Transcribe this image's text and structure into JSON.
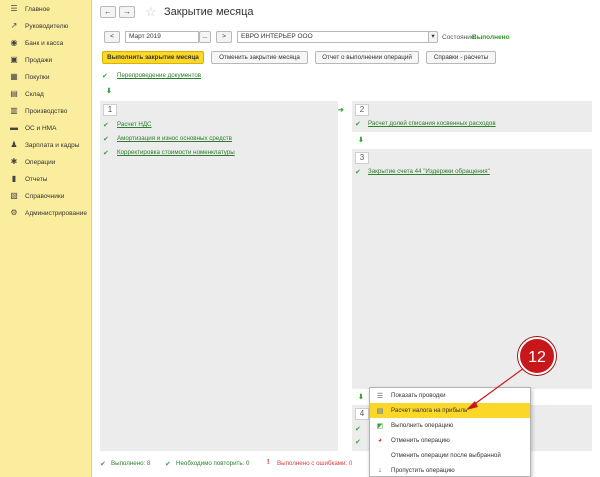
{
  "sidebar": {
    "items": [
      {
        "label": "Главное",
        "icon": "menu-icon"
      },
      {
        "label": "Руководителю",
        "icon": "chart-trend-icon"
      },
      {
        "label": "Банк и касса",
        "icon": "bank-icon"
      },
      {
        "label": "Продажи",
        "icon": "cart-sales-icon"
      },
      {
        "label": "Покупки",
        "icon": "cart-purchase-icon"
      },
      {
        "label": "Склад",
        "icon": "warehouse-icon"
      },
      {
        "label": "Производство",
        "icon": "factory-icon"
      },
      {
        "label": "ОС и НМА",
        "icon": "truck-icon"
      },
      {
        "label": "Зарплата и кадры",
        "icon": "people-icon"
      },
      {
        "label": "Операции",
        "icon": "operations-icon"
      },
      {
        "label": "Отчеты",
        "icon": "reports-icon"
      },
      {
        "label": "Справочники",
        "icon": "books-icon"
      },
      {
        "label": "Администрирование",
        "icon": "gear-icon"
      }
    ]
  },
  "header": {
    "back_icon": "←",
    "forward_icon": "→",
    "star_icon": "☆",
    "title": "Закрытие месяца"
  },
  "filters": {
    "prev": "<",
    "period": "Март 2019",
    "period_picker": "...",
    "next": ">",
    "organization": "ЕВРО ИНТЕРЬЕР ООО",
    "org_dropdown": "▾",
    "state_label": "Состояние:",
    "state_value": "Выполнено"
  },
  "toolbar": {
    "run": "Выполнить закрытие месяца",
    "cancel": "Отменить закрытие месяца",
    "report": "Отчет о выполнении операций",
    "help": "Справки - расчеты"
  },
  "top_link": "Перепроведение документов",
  "panel1": {
    "number": "1",
    "items": [
      "Расчет НДС",
      "Амортизация и износ основных средств",
      "Корректировка стоимости номенклатуры"
    ]
  },
  "panel2": {
    "number": "2",
    "items": [
      "Расчет долей списания косвенных расходов"
    ]
  },
  "panel3": {
    "number": "3",
    "items": [
      "Закрытие счета 44 \"Издержки обращения\""
    ]
  },
  "panel4": {
    "number": "4"
  },
  "glyphs": {
    "check": "✔",
    "down": "⬇",
    "right": "➔"
  },
  "status": {
    "done": "Выполнено: 8",
    "repeat": "Необходимо повторить: 0",
    "errors": "Выполнено с ошибками: 0"
  },
  "context_menu": {
    "items": [
      {
        "label": "Показать проводки",
        "icon": "postings-icon",
        "glyph": "☰"
      },
      {
        "label": "Расчет налога на прибыль",
        "icon": "calculate-icon",
        "glyph": "▤"
      },
      {
        "label": "Выполнить операцию",
        "icon": "execute-icon",
        "glyph": "◩"
      },
      {
        "label": "Отменить операцию",
        "icon": "cancel-op-icon",
        "glyph": "◕"
      },
      {
        "label": "Отменить операции после выбранной",
        "icon": "",
        "glyph": ""
      },
      {
        "label": "Пропустить операцию",
        "icon": "skip-icon",
        "glyph": "↓"
      }
    ]
  },
  "callout": {
    "number": "12"
  },
  "colors": {
    "accent": "#fbd728",
    "sidebar": "#fbed9e",
    "success": "#2d7d2d",
    "callout": "#c8171a"
  }
}
